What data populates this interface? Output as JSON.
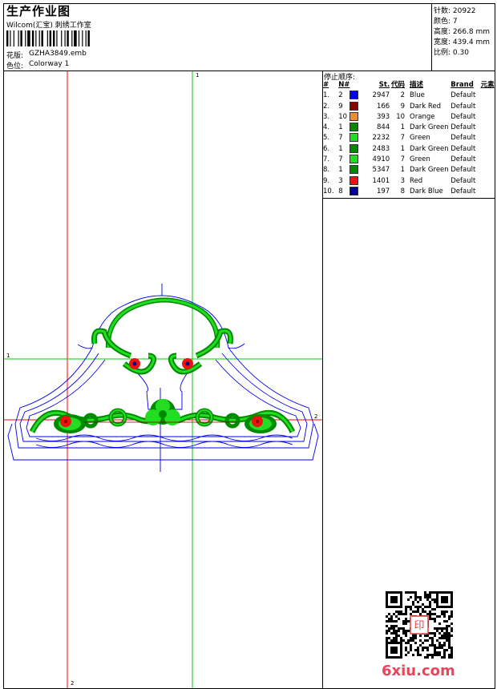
{
  "header": {
    "title": "生产作业图",
    "company": "Wilcom(汇宝) 刺绣工作室",
    "design_label": "花版:",
    "design_value": "GZHA3849.emb",
    "colorway_label": "色位:",
    "colorway_value": "Colorway 1"
  },
  "stats": {
    "stitches": "针数: 20922",
    "colors": "颜色: 7",
    "height": "高度: 266.8 mm",
    "width": "宽度: 439.4 mm",
    "scale": "比例: 0.30"
  },
  "stop_sequence": {
    "title": "停止顺序:",
    "headers": [
      "#",
      "N#",
      "St.",
      "代码",
      "描述",
      "Brand",
      "元素"
    ],
    "rows": [
      {
        "idx": "1.",
        "n": "2",
        "color": "#0000ff",
        "st": "2947",
        "code": "2",
        "desc": "Blue",
        "brand": "Default"
      },
      {
        "idx": "2.",
        "n": "9",
        "color": "#8b0000",
        "st": "166",
        "code": "9",
        "desc": "Dark Red",
        "brand": "Default"
      },
      {
        "idx": "3.",
        "n": "10",
        "color": "#f08a30",
        "st": "393",
        "code": "10",
        "desc": "Orange",
        "brand": "Default"
      },
      {
        "idx": "4.",
        "n": "1",
        "color": "#008a00",
        "st": "844",
        "code": "1",
        "desc": "Dark Green",
        "brand": "Default"
      },
      {
        "idx": "5.",
        "n": "7",
        "color": "#22dd22",
        "st": "2232",
        "code": "7",
        "desc": "Green",
        "brand": "Default"
      },
      {
        "idx": "6.",
        "n": "1",
        "color": "#008a00",
        "st": "2483",
        "code": "1",
        "desc": "Dark Green",
        "brand": "Default"
      },
      {
        "idx": "7.",
        "n": "7",
        "color": "#22dd22",
        "st": "4910",
        "code": "7",
        "desc": "Green",
        "brand": "Default"
      },
      {
        "idx": "8.",
        "n": "1",
        "color": "#008a00",
        "st": "5347",
        "code": "1",
        "desc": "Dark Green",
        "brand": "Default"
      },
      {
        "idx": "9.",
        "n": "3",
        "color": "#ee1111",
        "st": "1401",
        "code": "3",
        "desc": "Red",
        "brand": "Default"
      },
      {
        "idx": "10.",
        "n": "8",
        "color": "#000090",
        "st": "197",
        "code": "8",
        "desc": "Dark Blue",
        "brand": "Default"
      }
    ]
  },
  "guides": {
    "top_label": "1",
    "left_label": "1",
    "bottom_label": "2",
    "right_label": "2"
  },
  "watermark": {
    "site": "6xiu.com",
    "seal": "印"
  }
}
